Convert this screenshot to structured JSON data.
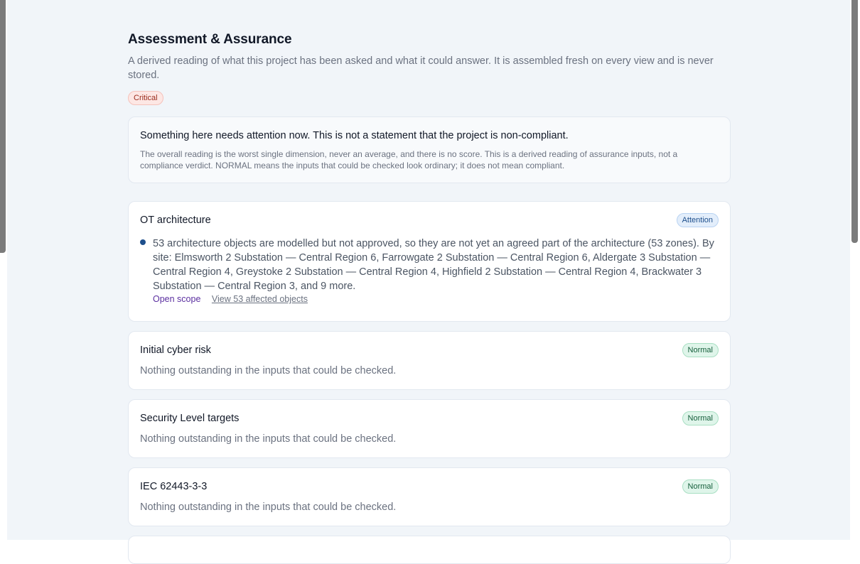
{
  "page": {
    "title": "Assessment & Assurance",
    "subtitle": "A derived reading of what this project has been asked and what it could answer. It is assembled fresh on every view and is never stored.",
    "overall_badge": "Critical"
  },
  "summary": {
    "headline": "Something here needs attention now. This is not a statement that the project is non-compliant.",
    "note": "The overall reading is the worst single dimension, never an average, and there is no score. This is a derived reading of assurance inputs, not a compliance verdict. NORMAL means the inputs that could be checked look ordinary; it does not mean compliant."
  },
  "dimensions": [
    {
      "title": "OT architecture",
      "status": "Attention",
      "finding": "53 architecture objects are modelled but not approved, so they are not yet an agreed part of the architecture (53 zones). By site: Elmsworth 2 Substation — Central Region 6, Farrowgate 2 Substation — Central Region 6, Aldergate 3 Substation — Central Region 4, Greystoke 2 Substation — Central Region 4, Highfield 2 Substation — Central Region 4, Brackwater 3 Substation — Central Region 3, and 9 more.",
      "link_scope": "Open scope",
      "link_view": "View 53 affected objects"
    },
    {
      "title": "Initial cyber risk",
      "status": "Normal",
      "body": "Nothing outstanding in the inputs that could be checked."
    },
    {
      "title": "Security Level targets",
      "status": "Normal",
      "body": "Nothing outstanding in the inputs that could be checked."
    },
    {
      "title": "IEC 62443-3-3",
      "status": "Normal",
      "body": "Nothing outstanding in the inputs that could be checked."
    }
  ],
  "colors": {
    "critical": "#9a2b1c",
    "attention": "#1e4f8c",
    "normal": "#17603d",
    "link_accent": "#5b2fa0"
  }
}
